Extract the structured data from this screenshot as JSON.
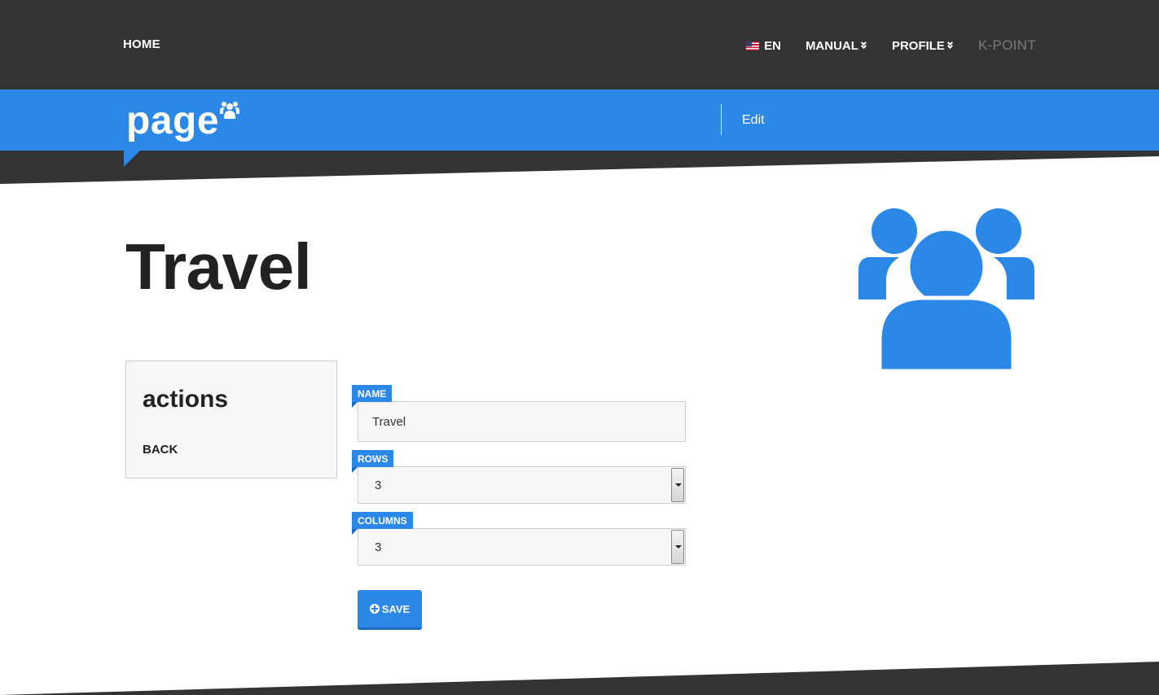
{
  "nav": {
    "home": "HOME",
    "language": "EN",
    "manual": "MANUAL",
    "profile": "PROFILE",
    "kpoint": "K-POINT"
  },
  "banner": {
    "brand": "page",
    "brand_icon": "users-icon",
    "edit": "Edit"
  },
  "page": {
    "title": "Travel",
    "hero_icon": "users-icon"
  },
  "actions": {
    "title": "actions",
    "back": "BACK"
  },
  "form": {
    "name_label": "NAME",
    "name_value": "Travel",
    "rows_label": "ROWS",
    "rows_value": "3",
    "columns_label": "COLUMNS",
    "columns_value": "3",
    "save_label": "SAVE"
  },
  "colors": {
    "accent": "#2b88e6",
    "dark": "#333333",
    "panel": "#f7f7f7"
  }
}
